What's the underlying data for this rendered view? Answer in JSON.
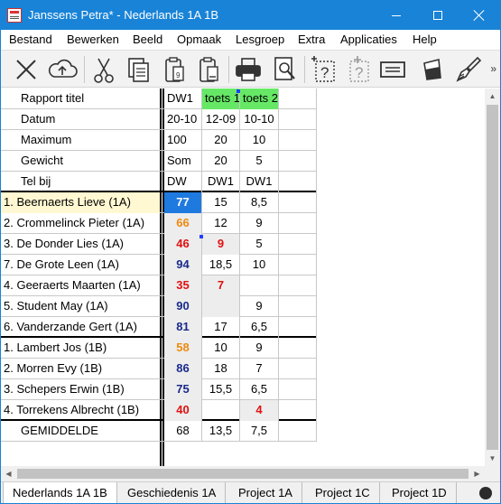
{
  "window": {
    "title": "Janssens Petra* - Nederlands 1A 1B",
    "controls": [
      "minimize",
      "maximize",
      "close"
    ]
  },
  "menu": [
    "Bestand",
    "Bewerken",
    "Beeld",
    "Opmaak",
    "Lesgroep",
    "Extra",
    "Applicaties",
    "Help"
  ],
  "toolbar": {
    "icons": [
      "close-x-icon",
      "cloud-upload-icon",
      "scissors-icon",
      "copy-icon",
      "paste-icon",
      "paste-special-icon",
      "printer-icon",
      "print-preview-icon",
      "insert-question-icon",
      "insert-question-disabled-icon",
      "textbox-icon",
      "fill-bucket-icon",
      "brush-icon"
    ],
    "more": "»"
  },
  "header_rows": [
    {
      "label": "Rapport titel",
      "cells": [
        "DW1",
        "toets 1",
        "toets 2",
        ""
      ]
    },
    {
      "label": "Datum",
      "cells": [
        "20-10",
        "12-09",
        "10-10",
        ""
      ]
    },
    {
      "label": "Maximum",
      "cells": [
        "100",
        "20",
        "10",
        ""
      ]
    },
    {
      "label": "Gewicht",
      "cells": [
        "Som",
        "20",
        "5",
        ""
      ]
    },
    {
      "label": "Tel bij",
      "cells": [
        "DW",
        "DW1",
        "DW1",
        ""
      ]
    }
  ],
  "students": [
    {
      "label": "1. Beernaerts Lieve (1A)",
      "cells": [
        "77",
        "15",
        "8,5",
        ""
      ]
    },
    {
      "label": "2. Crommelinck Pieter (1A)",
      "cells": [
        "66",
        "12",
        "9",
        ""
      ]
    },
    {
      "label": "3. De Donder Lies (1A)",
      "cells": [
        "46",
        "9",
        "5",
        ""
      ]
    },
    {
      "label": "7. De Grote Leen (1A)",
      "cells": [
        "94",
        "18,5",
        "10",
        ""
      ]
    },
    {
      "label": "4. Geeraerts Maarten (1A)",
      "cells": [
        "35",
        "7",
        "",
        ""
      ]
    },
    {
      "label": "5. Student May (1A)",
      "cells": [
        "90",
        "",
        "9",
        ""
      ]
    },
    {
      "label": "6. Vanderzande Gert (1A)",
      "cells": [
        "81",
        "17",
        "6,5",
        ""
      ]
    },
    {
      "label": "1. Lambert Jos (1B)",
      "cells": [
        "58",
        "10",
        "9",
        ""
      ]
    },
    {
      "label": "2. Morren Evy (1B)",
      "cells": [
        "86",
        "18",
        "7",
        ""
      ]
    },
    {
      "label": "3. Schepers Erwin (1B)",
      "cells": [
        "75",
        "15,5",
        "6,5",
        ""
      ]
    },
    {
      "label": "4. Torrekens Albrecht (1B)",
      "cells": [
        "40",
        "",
        "4",
        ""
      ]
    }
  ],
  "average_row": {
    "label": "GEMIDDELDE",
    "cells": [
      "68",
      "13,5",
      "7,5",
      ""
    ]
  },
  "tabs": [
    "Nederlands 1A 1B",
    "Geschiedenis 1A",
    "Project 1A",
    "Project 1C",
    "Project 1D"
  ],
  "colors": {
    "titlebar": "#1883d7",
    "score_high": "#1a2a8a",
    "score_low": "#e01010",
    "score_mid": "#ee8a10",
    "selection": "#1f7ae0",
    "header_green": "#66e866"
  }
}
